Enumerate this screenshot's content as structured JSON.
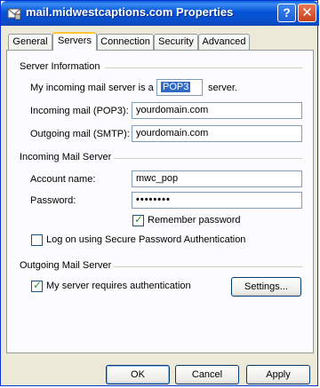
{
  "window": {
    "title": "mail.midwestcaptions.com Properties",
    "help_glyph": "?",
    "close_glyph": "✕"
  },
  "tabs": [
    {
      "label": "General"
    },
    {
      "label": "Servers"
    },
    {
      "label": "Connection"
    },
    {
      "label": "Security"
    },
    {
      "label": "Advanced"
    }
  ],
  "active_tab": "Servers",
  "server_info": {
    "group_label": "Server Information",
    "incoming_type_prefix": "My incoming mail server is a",
    "incoming_type_value": "POP3",
    "incoming_type_suffix": "server.",
    "incoming_label": "Incoming mail (POP3):",
    "incoming_value": "yourdomain.com",
    "outgoing_label": "Outgoing mail (SMTP):",
    "outgoing_value": "yourdomain.com"
  },
  "incoming_server": {
    "group_label": "Incoming Mail Server",
    "account_label": "Account name:",
    "account_value": "mwc_pop",
    "password_label": "Password:",
    "password_value": "••••••••",
    "remember_label": "Remember password",
    "remember_checked": true,
    "spa_label": "Log on using Secure Password Authentication",
    "spa_checked": false
  },
  "outgoing_server": {
    "group_label": "Outgoing Mail Server",
    "auth_label": "My server requires authentication",
    "auth_checked": true,
    "settings_label": "Settings..."
  },
  "buttons": {
    "ok": "OK",
    "cancel": "Cancel",
    "apply": "Apply"
  },
  "colors": {
    "titlebar": "#0553d6",
    "window_bg": "#ece9d8",
    "tab_highlight": "#ffc83c",
    "selection": "#316ac5"
  }
}
